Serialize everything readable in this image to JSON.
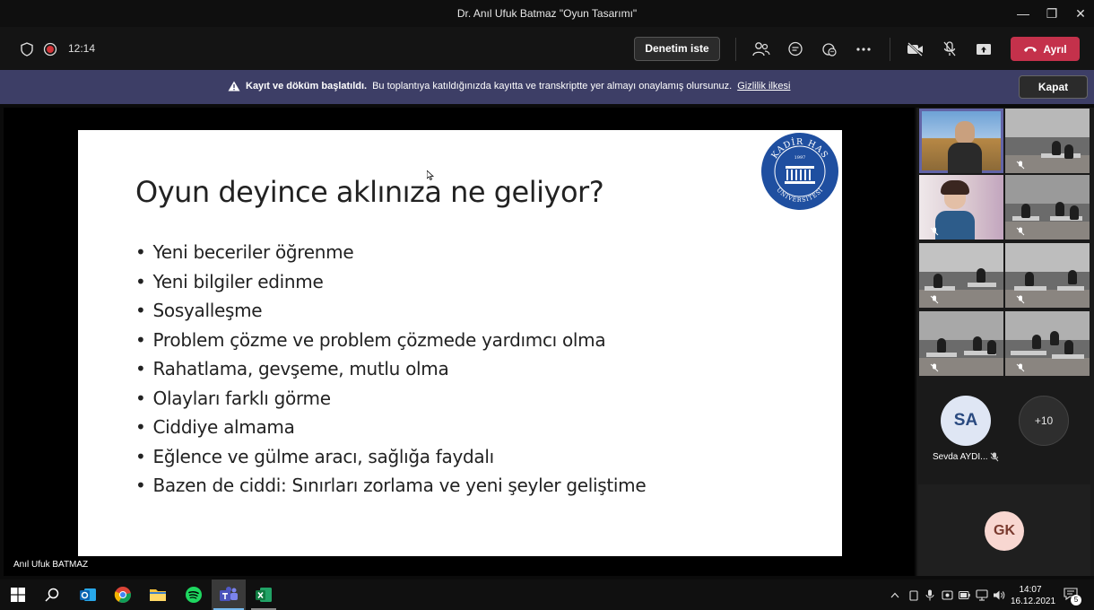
{
  "window": {
    "title": "Dr. Anıl Ufuk Batmaz \"Oyun Tasarımı\"",
    "minimize_glyph": "—",
    "maximize_glyph": "❐",
    "close_glyph": "✕"
  },
  "toolbar": {
    "timer": "12:14",
    "request_control_label": "Denetim iste",
    "leave_label": "Ayrıl",
    "icons": [
      "shield-icon",
      "record-icon",
      "participants-icon",
      "chat-icon",
      "reactions-icon",
      "more-icon",
      "camera-off-icon",
      "mic-off-icon",
      "share-icon",
      "phone-icon"
    ]
  },
  "banner": {
    "bold_text": "Kayıt ve döküm başlatıldı.",
    "text": "Bu toplantıya katıldığınızda kayıtta ve transkriptte yer almayı onaylamış olursunuz.",
    "link_text": "Gizlilik ilkesi",
    "close_label": "Kapat"
  },
  "slide": {
    "title": "Oyun deyince aklınıza ne geliyor?",
    "bullets": [
      "Yeni beceriler öğrenme",
      "Yeni bilgiler edinme",
      "Sosyalleşme",
      "Problem çözme ve problem çözmede yardımcı olma",
      "Rahatlama, gevşeme, mutlu olma",
      "Olayları farklı görme",
      "Ciddiye almama",
      "Eğlence ve gülme aracı, sağlığa faydalı",
      "Bazen de ciddi: Sınırları zorlama ve yeni şeyler geliştime"
    ],
    "logo": {
      "top_text": "KADİR HAS",
      "year": "1997",
      "bottom_text": "ÜNİVERSİTESİ"
    }
  },
  "presenter_name": "Anıl Ufuk BATMAZ",
  "participants": {
    "sa_initials": "SA",
    "sa_name": "Sevda AYDI...",
    "more_count": "+10",
    "gk_initials": "GK"
  },
  "colors": {
    "accent": "#6264a7",
    "leave": "#c4314b",
    "banner": "#3d3e66",
    "sa_avatar": "#dfe6f4",
    "gk_avatar": "#f8d7d1"
  },
  "taskbar": {
    "time": "14:07",
    "date": "16.12.2021",
    "notification_count": "5",
    "apps": [
      "windows-icon",
      "search-icon",
      "outlook-icon",
      "chrome-icon",
      "explorer-icon",
      "spotify-icon",
      "teams-icon",
      "excel-icon"
    ]
  }
}
